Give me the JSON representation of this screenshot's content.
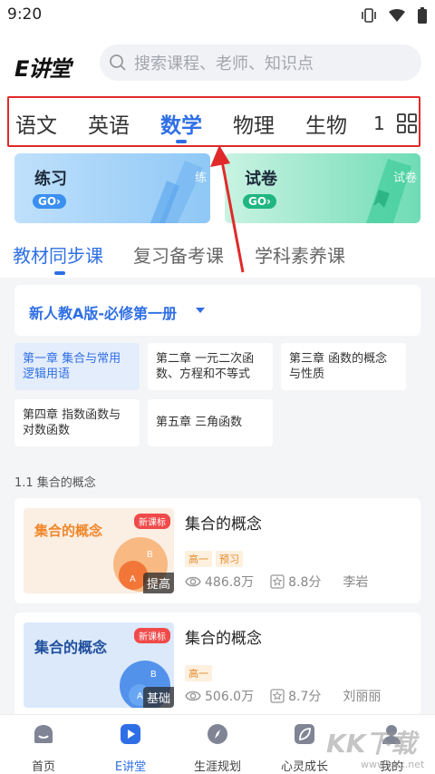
{
  "status": {
    "time": "9:20"
  },
  "header": {
    "logo": "E讲堂",
    "search_placeholder": "搜索课程、老师、知识点"
  },
  "subjects": {
    "items": [
      "语文",
      "英语",
      "数学",
      "物理",
      "生物"
    ],
    "active": "数学",
    "partial": "1"
  },
  "cards": {
    "practice": {
      "title": "练习",
      "go": "GO›",
      "deco": "练"
    },
    "paper": {
      "title": "试卷",
      "go": "GO›",
      "deco": "试卷"
    }
  },
  "tabs": {
    "items": [
      "教材同步课",
      "复习备考课",
      "学科素养课"
    ],
    "active": "教材同步课"
  },
  "edition": {
    "label": "新人教A版-必修第一册"
  },
  "chapters": [
    "第一章 集合与常用逻辑用语",
    "第二章 一元二次函数、方程和不等式",
    "第三章 函数的概念与性质",
    "第四章 指数函数与对数函数",
    "第五章 三角函数"
  ],
  "topic": "1.1 集合的概念",
  "courses": [
    {
      "thumb_title": "集合的概念",
      "badge": "新课标",
      "level": "提高",
      "title": "集合的概念",
      "tags": [
        "高一",
        "预习"
      ],
      "views": "486.8万",
      "score": "8.8分",
      "teacher": "李岩",
      "venn_a": "A",
      "venn_b": "B"
    },
    {
      "thumb_title": "集合的概念",
      "badge": "新课标",
      "level": "基础",
      "title": "集合的概念",
      "tags": [
        "高一"
      ],
      "views": "506.0万",
      "score": "8.7分",
      "teacher": "刘丽丽",
      "venn_a": "A",
      "venn_b": "B"
    }
  ],
  "bottom_nav": {
    "items": [
      "首页",
      "E讲堂",
      "生涯规划",
      "心灵成长",
      "我的"
    ],
    "active": "E讲堂"
  },
  "watermark": {
    "text": "KK下载",
    "url": "www.kkx.net"
  },
  "colors": {
    "accent": "#2f6fe5",
    "annotation": "#e02a2a",
    "orange": "#f0872a"
  }
}
